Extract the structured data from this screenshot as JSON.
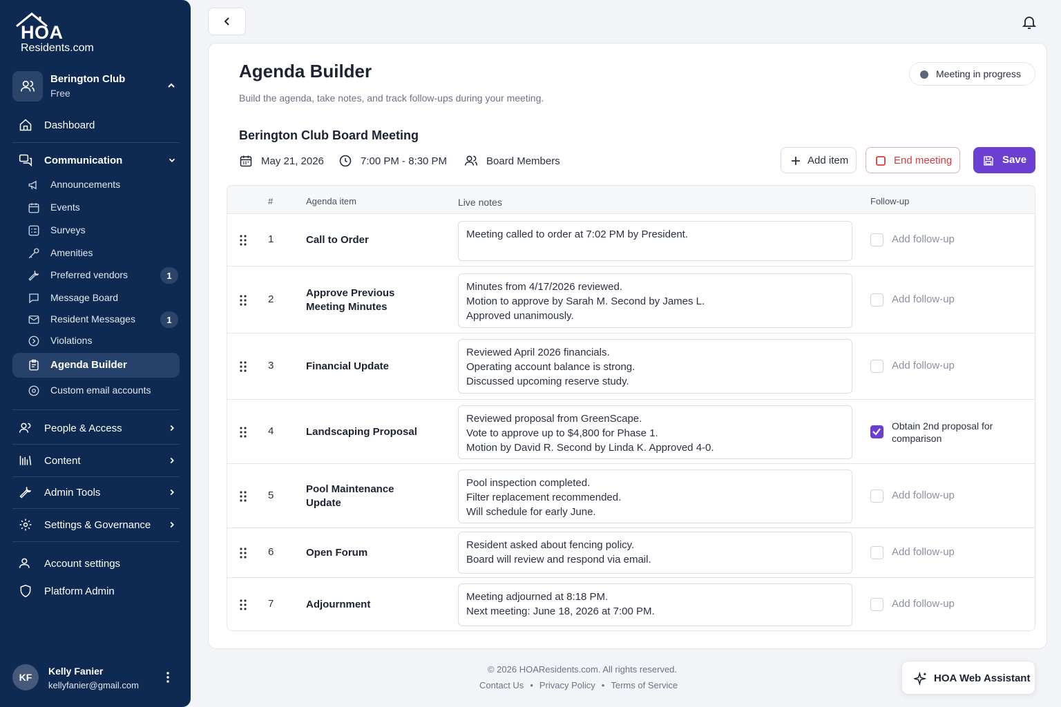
{
  "brand": {
    "logo_text": "HOA",
    "logo_sub": "Residents.com"
  },
  "club": {
    "name": "Berington Club",
    "plan": "Free"
  },
  "nav": {
    "dashboard": "Dashboard",
    "communication": "Communication",
    "sub_items": [
      {
        "label": "Announcements",
        "icon": "megaphone-icon",
        "badge": ""
      },
      {
        "label": "Events",
        "icon": "calendar-icon",
        "badge": ""
      },
      {
        "label": "Surveys",
        "icon": "survey-icon",
        "badge": ""
      },
      {
        "label": "Amenities",
        "icon": "key-icon",
        "badge": ""
      },
      {
        "label": "Preferred vendors",
        "icon": "tool-icon",
        "badge": "1"
      },
      {
        "label": "Message Board",
        "icon": "chat-icon",
        "badge": ""
      },
      {
        "label": "Resident Messages",
        "icon": "mail-icon",
        "badge": "1"
      },
      {
        "label": "Violations",
        "icon": "shield-icon",
        "badge": ""
      },
      {
        "label": "Agenda Builder",
        "icon": "clipboard-icon",
        "badge": ""
      },
      {
        "label": "Custom email accounts",
        "icon": "at-icon",
        "badge": ""
      }
    ],
    "people_access": "People & Access",
    "content": "Content",
    "admin_tools": "Admin Tools",
    "settings_governance": "Settings & Governance",
    "account_settings": "Account settings",
    "platform_admin": "Platform Admin"
  },
  "user": {
    "initials": "KF",
    "name": "Kelly Fanier",
    "email": "kellyfanier@gmail.com"
  },
  "page": {
    "title": "Agenda Builder",
    "subtitle": "Build the agenda, take notes, and track follow-ups during your meeting.",
    "status": "Meeting in progress"
  },
  "meeting": {
    "title": "Berington Club Board Meeting",
    "date": "May 21, 2026",
    "time": "7:00 PM - 8:30 PM",
    "attendees": "Board Members"
  },
  "actions": {
    "add_item": "Add item",
    "end_meeting": "End meeting",
    "save": "Save"
  },
  "table": {
    "headers": {
      "num": "#",
      "item": "Agenda item",
      "notes": "Live notes",
      "followup": "Follow-up"
    },
    "rows": [
      {
        "num": "1",
        "item": "Call to Order",
        "notes": [
          "Meeting called to order at 7:02 PM by President."
        ],
        "followup": "Add follow-up",
        "checked": false
      },
      {
        "num": "2",
        "item": "Approve Previous Meeting Minutes",
        "notes": [
          "Minutes from 4/17/2026 reviewed.",
          "Motion to approve by Sarah M. Second by James L.",
          "Approved unanimously."
        ],
        "followup": "Add follow-up",
        "checked": false
      },
      {
        "num": "3",
        "item": "Financial Update",
        "notes": [
          "Reviewed April 2026 financials.",
          "Operating account balance is strong.",
          "Discussed upcoming reserve study."
        ],
        "followup": "Add follow-up",
        "checked": false
      },
      {
        "num": "4",
        "item": "Landscaping Proposal",
        "notes": [
          "Reviewed proposal from GreenScape.",
          "Vote to approve up to $4,800 for Phase 1.",
          "Motion by David R. Second by Linda K. Approved 4-0."
        ],
        "followup": "Obtain 2nd proposal for comparison",
        "checked": true
      },
      {
        "num": "5",
        "item": "Pool Maintenance Update",
        "notes": [
          "Pool inspection completed.",
          "Filter replacement recommended.",
          "Will schedule for early June."
        ],
        "followup": "Add follow-up",
        "checked": false
      },
      {
        "num": "6",
        "item": "Open Forum",
        "notes": [
          "Resident asked about fencing policy.",
          "Board will review and respond via email."
        ],
        "followup": "Add follow-up",
        "checked": false
      },
      {
        "num": "7",
        "item": "Adjournment",
        "notes": [
          "Meeting adjourned at 8:18 PM.",
          "Next meeting: June 18, 2026 at 7:00 PM."
        ],
        "followup": "Add follow-up",
        "checked": false
      }
    ]
  },
  "footer": {
    "copyright": "© 2026 HOAResidents.com. All rights reserved.",
    "contact": "Contact Us",
    "privacy": "Privacy Policy",
    "terms": "Terms of Service",
    "separator": "•"
  },
  "assistant": {
    "label": "HOA Web Assistant"
  },
  "colors": {
    "sidebar": "#0f2a52",
    "accent": "#6b3fd1",
    "danger": "#d63a3a"
  }
}
